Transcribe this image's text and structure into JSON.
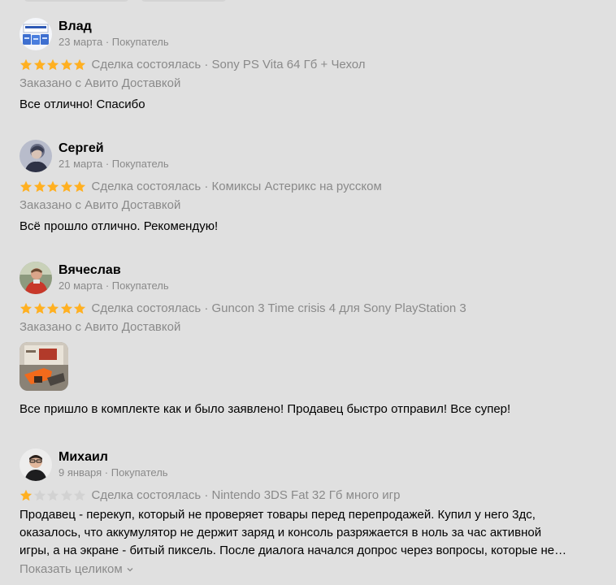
{
  "rating_color": "#ffb021",
  "rating_empty_color": "#d2d2d2",
  "reviews": [
    {
      "name": "Влад",
      "meta": "23 марта · Покупатель",
      "rating": 5,
      "deal": "Сделка состоялась · Sony PS Vita 64 Гб + Чехол",
      "delivery": "Заказано с Авито Доставкой",
      "text": "Все отлично! Спасибо",
      "avatar_icon": "product-box-avatar"
    },
    {
      "name": "Сергей",
      "meta": "21 марта · Покупатель",
      "rating": 5,
      "deal": "Сделка состоялась · Комиксы Астерикс на русском",
      "delivery": "Заказано с Авито Доставкой",
      "text": "Всё прошло отлично. Рекомендую!",
      "avatar_icon": "person-avatar"
    },
    {
      "name": "Вячеслав",
      "meta": "20 марта · Покупатель",
      "rating": 5,
      "deal": "Сделка состоялась · Guncon 3 Time crisis 4 для Sony PlayStation 3",
      "delivery": "Заказано с Авито Доставкой",
      "text": "Все пришло в комплекте как и было заявлено! Продавец быстро отправил! Все супер!",
      "avatar_icon": "person-avatar",
      "photo_icon": "review-photo"
    },
    {
      "name": "Михаил",
      "meta": "9 января · Покупатель",
      "rating": 1,
      "deal": "Сделка состоялась · Nintendo 3DS Fat 32 Гб много игр",
      "text_lines": [
        "Продавец - перекуп, который не проверяет товары перед перепродажей. Купил у него 3дс,",
        "оказалось, что аккумулятор не держит заряд и консоль разряжается в ноль за час активной",
        "игры, а на экране - битый пиксель. После диалога начался допрос через вопросы, которые не…"
      ],
      "show_more": "Показать целиком",
      "avatar_icon": "person-avatar"
    }
  ]
}
